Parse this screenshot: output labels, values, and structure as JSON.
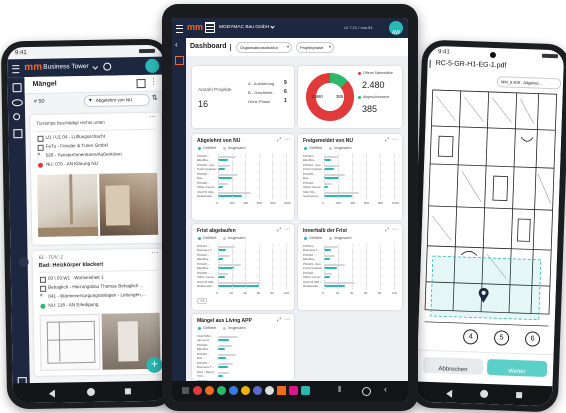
{
  "colors": {
    "accent": "#f06a1f",
    "teal": "#2ab8b4",
    "red": "#e03a3a",
    "green": "#2eb86a",
    "navy": "#1d2740"
  },
  "left_phone": {
    "time": "9:41",
    "brand": "mm",
    "project": "Business Tower",
    "section_title": "Mängel",
    "count": "# 50",
    "filter_label": "Abgelehnt von NU",
    "card1": {
      "title": "Türrampe beschädigt rechts unten",
      "items": [
        "U1 \\ U1.04 - Lüftungsschacht",
        "FeTu - Fenster & Türen GmbH",
        "026 - Fenster/Innentüren/Außentüren",
        "NU: 070 - AN Klärung NU"
      ]
    },
    "card2": {
      "id": "61 - TÜV_1",
      "title": "Bad: Heizkörper klackert",
      "items": [
        "03 \\ 03.W1 - Wohneinheit 1",
        "Behaglich - Heizungsbau Thomas Behaglich ...",
        "041 - Wärmeversorgungsanlagen - Leitungen,...",
        "NU: 118 - AN Erledigung"
      ]
    },
    "fab_icon": "plus-icon"
  },
  "tablet": {
    "app_name": "MODYMAC Bau GmbH",
    "version": "v2.7.21 / mia.94",
    "avatar": "AW",
    "title": "Dashboard",
    "filter1": "Organisationsstruktur",
    "filter2": "Projektphase",
    "summary": {
      "projects_label": "Anzahl Projekte",
      "projects_value": "16",
      "phases": [
        {
          "label": "A - Ausführung",
          "value": "9"
        },
        {
          "label": "B - Gewährlei...",
          "value": "6"
        },
        {
          "label": "Ohne Phase",
          "value": "1"
        }
      ]
    },
    "donut": {
      "center_left": "2.860",
      "center_right": "385",
      "legend": [
        {
          "label": "Offene Datensätze",
          "value": "2.480",
          "color": "#e03a3a"
        },
        {
          "label": "Abgeschlossene",
          "value": "385",
          "color": "#2eb86a"
        }
      ]
    },
    "status_legend": {
      "filtered": "Gefiltert",
      "total": "Insgesamt"
    },
    "panels": [
      {
        "title": "Abgelehnt von NU",
        "rows": [
          "POG01 - Elkoffice...",
          "POG02 - Aus Punkt Quartier",
          "POG05 - Bus...",
          "POG06 - Office Center",
          "UG27/4 002 - Reklamatio..."
        ],
        "ticks": [
          "0",
          "200",
          "400",
          "600",
          "800",
          "1000"
        ]
      },
      {
        "title": "Freigemeldet von NU",
        "rows": [
          "POG01 - Elkoffice...",
          "POG02 - Aus Punkt Quartier",
          "POG05 - Bus...",
          "POG06 - Office Center",
          "SN1Y01 - Strumpeng..."
        ],
        "ticks": [
          "0",
          "200",
          "400",
          "600",
          "800",
          "1000"
        ]
      },
      {
        "title": "Frist abgelaufen",
        "rows": [
          "POG01 - Business T...",
          "POG02 - Elkoffice...",
          "POG03 - Elkoffice...",
          "POG05 - Office Center",
          "UG27/4 002 - Reklamatio..."
        ],
        "ticks": [
          "0",
          "20",
          "40",
          "60",
          "80",
          "100"
        ],
        "more": "+1"
      },
      {
        "title": "Innerhalb der Frist",
        "rows": [
          "POG01 - Business T...",
          "POG02 - Elkoffice...",
          "POG03 - Aus Punkt Quartier",
          "POG06 - Office Center",
          "UG27/4 002 - Reklamatio..."
        ],
        "ticks": [
          "0",
          "20",
          "40",
          "60",
          "80",
          "100"
        ]
      },
      {
        "title": "Mängel aus Living APP",
        "rows": [
          "UG27A81 - Jan Lenz 81M...",
          "POG02 - Elkoffice...",
          "POG02 - Bus...",
          "POG05 - Business T...",
          "DG1 - Dienst TÜV...",
          "POG04 - Business T..."
        ],
        "ticks": []
      }
    ]
  },
  "right_phone": {
    "time": "9:41",
    "filename": "RC-5-GR-H1-EG-1.pdf",
    "badge": "MM_6.409 - Allgemei...",
    "axis_labels": [
      "4",
      "5",
      "6"
    ],
    "cancel_label": "Abbrechen",
    "next_label": "Weiter"
  }
}
